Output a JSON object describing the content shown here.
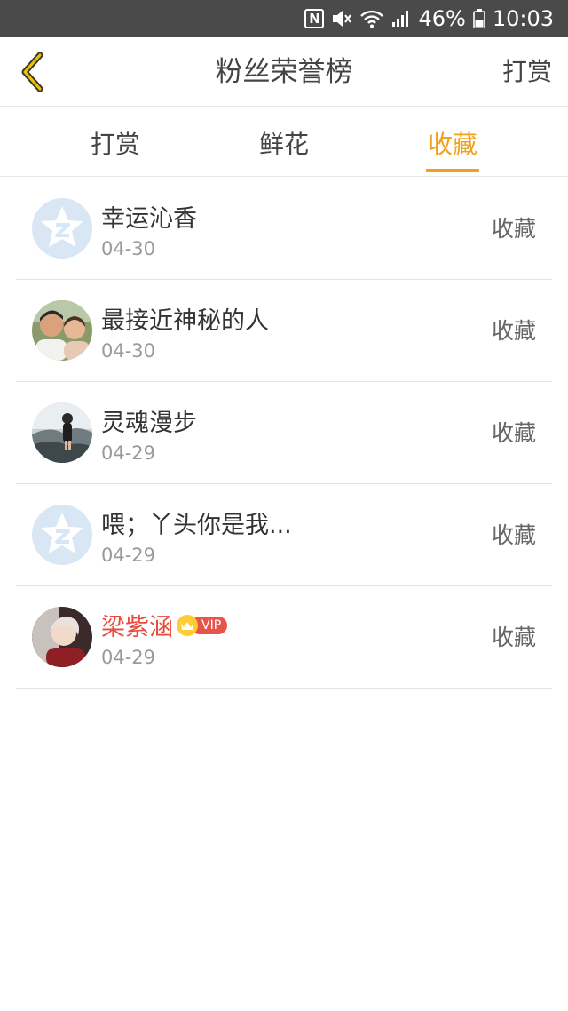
{
  "status_bar": {
    "battery": "46%",
    "time": "10:03",
    "icons": [
      "nfc-icon",
      "mute-icon",
      "wifi-icon",
      "signal-icon",
      "battery-icon"
    ]
  },
  "header": {
    "back_icon": "chevron-left-icon",
    "title": "粉丝荣誉榜",
    "right_action": "打赏"
  },
  "tabs": [
    {
      "label": "打赏",
      "active": false
    },
    {
      "label": "鲜花",
      "active": false
    },
    {
      "label": "收藏",
      "active": true
    }
  ],
  "colors": {
    "accent": "#f0a21f",
    "status_bar": "#4a4a4a",
    "vip_name": "#e84b3c",
    "vip_tag": "#e8534a",
    "date": "#9a9a9a"
  },
  "list": [
    {
      "name": "幸运沁香",
      "date": "04-30",
      "action": "收藏",
      "avatar": "default-star-avatar",
      "vip": false
    },
    {
      "name": "最接近神秘的人",
      "date": "04-30",
      "action": "收藏",
      "avatar": "photo-avatar-couple",
      "vip": false
    },
    {
      "name": "灵魂漫步",
      "date": "04-29",
      "action": "收藏",
      "avatar": "photo-avatar-landscape",
      "vip": false
    },
    {
      "name": "喂；丫头你是我...",
      "date": "04-29",
      "action": "收藏",
      "avatar": "default-star-avatar",
      "vip": false
    },
    {
      "name": "梁紫涵",
      "date": "04-29",
      "action": "收藏",
      "avatar": "photo-avatar-person",
      "vip": true,
      "vip_label": "VIP"
    }
  ]
}
